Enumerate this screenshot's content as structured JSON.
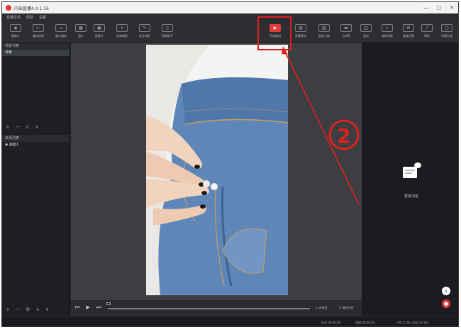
{
  "window": {
    "title": "闪出直播4.0.1.16",
    "controls": [
      "—",
      "▢",
      "✕"
    ]
  },
  "menu": [
    "直播文件",
    "帮助",
    "设置"
  ],
  "toolbar": {
    "left_tools": [
      {
        "label": "摄像头",
        "icon": "camera-icon"
      },
      {
        "label": "媒体视频",
        "icon": "video-icon"
      },
      {
        "label": "窗口捕捉",
        "icon": "window-icon"
      },
      {
        "label": "图片",
        "icon": "image-icon"
      },
      {
        "label": "投屏卡",
        "icon": "cast-icon"
      },
      {
        "label": "区域捕捉",
        "icon": "region-icon"
      },
      {
        "label": "标注捕捉",
        "icon": "annotate-icon"
      },
      {
        "label": "投屏助手",
        "icon": "phone-icon"
      }
    ],
    "right_tools": [
      {
        "label": "开始推流",
        "icon": "play-icon",
        "live": true
      },
      {
        "label": "直播模式",
        "icon": "mode-icon"
      },
      {
        "label": "智能分屏",
        "icon": "split-icon"
      },
      {
        "label": "分辨率",
        "icon": "resolution-icon"
      },
      {
        "label": "画质",
        "icon": "quality-icon"
      },
      {
        "label": "虚拟背景",
        "icon": "bg-icon"
      },
      {
        "label": "高级设置",
        "icon": "settings-icon"
      },
      {
        "label": "帮助",
        "icon": "help-icon"
      },
      {
        "label": "问题反馈",
        "icon": "feedback-icon"
      }
    ]
  },
  "left_panel": {
    "scenes_header": "场景列表",
    "scene_items": [
      "场景"
    ],
    "scene_controls": "+ − ∧ ∨",
    "sources_header": "来源列表",
    "source_items": [
      "◉ 画面1"
    ],
    "source_controls": "+ − ⚙ ∧ ∨"
  },
  "player": {
    "prev": "⏮",
    "play": "▶",
    "next": "⏭",
    "label_a": "◎ 原始音",
    "label_b": "⊕ 播放列表"
  },
  "right_panel": {
    "empty_label": "暂无内容"
  },
  "status": {
    "duration": "时长 00:00:00",
    "net": "网络 00:00:00",
    "cpu": "CPU 2.3%, 内存 0.0 fps"
  },
  "annotation": {
    "number": "②",
    "color": "#e02020"
  },
  "colors": {
    "live_red": "#e23d3d",
    "bg_dark": "#252629",
    "denim": "#5f86b8"
  }
}
